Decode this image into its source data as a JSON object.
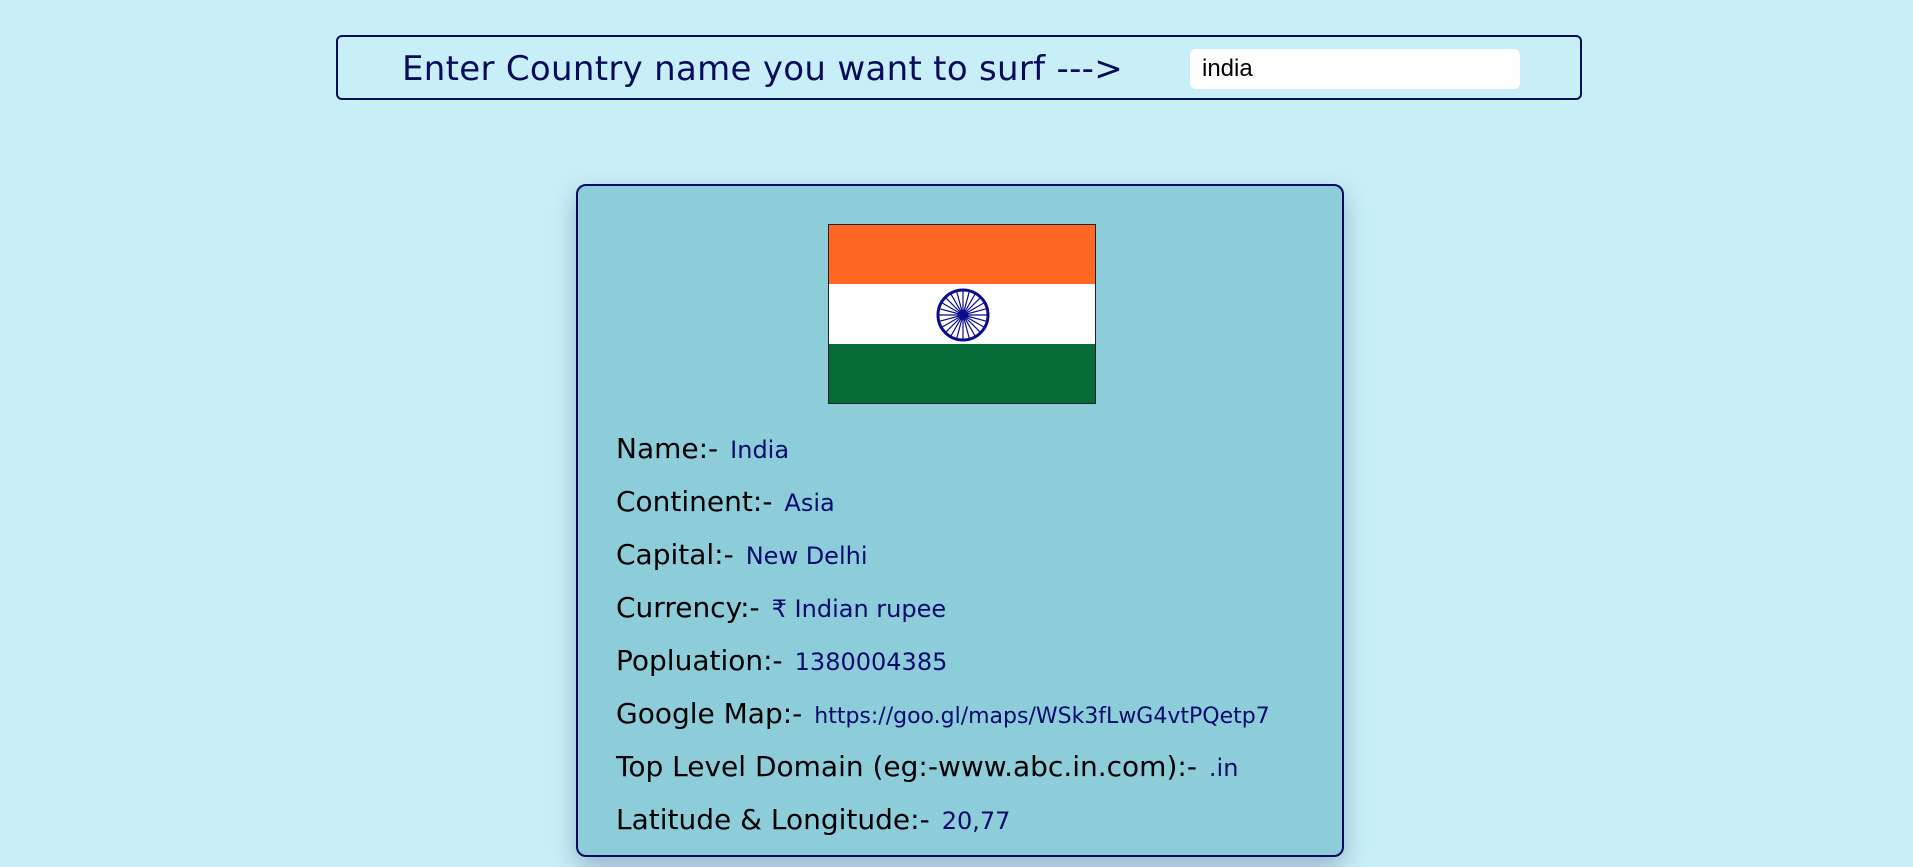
{
  "search": {
    "label": "Enter Country name you want to surf --->",
    "value": "india"
  },
  "card": {
    "flag": {
      "icon": "indian-flag",
      "colors": {
        "top": "#ff6723",
        "middle": "#ffffff",
        "bottom": "#046a38",
        "chakra": "#0b0b8f"
      }
    },
    "fields": [
      {
        "key": "Name:-",
        "value": "India"
      },
      {
        "key": "Continent:-",
        "value": "Asia"
      },
      {
        "key": "Capital:-",
        "value": "New Delhi"
      },
      {
        "key": "Currency:-",
        "value": "₹ Indian rupee"
      },
      {
        "key": "Popluation:-",
        "value": "1380004385"
      },
      {
        "key": "Google Map:-",
        "value": "https://goo.gl/maps/WSk3fLwG4vtPQetp7"
      },
      {
        "key": "Top Level Domain (eg:-www.abc.in.com):-",
        "value": ".in"
      },
      {
        "key": "Latitude & Longitude:-",
        "value": "20,77"
      }
    ]
  },
  "theme": {
    "page_background": "#c8eff7",
    "card_background": "#8dcdda",
    "accent": "#0b0b5c"
  }
}
